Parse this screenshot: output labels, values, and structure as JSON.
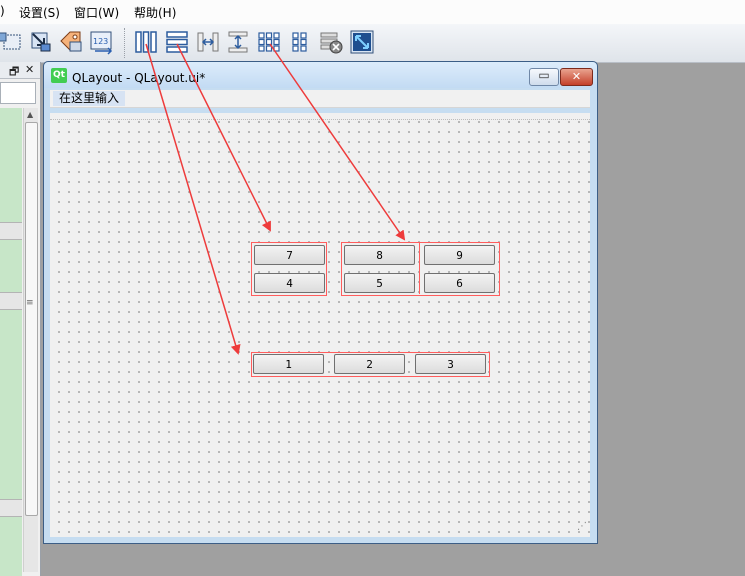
{
  "menubar": {
    "items": [
      ")",
      "设置(S)",
      "窗口(W)",
      "帮助(H)"
    ]
  },
  "toolbar": {
    "buttons": [
      "adjust-size-icon",
      "widget-editing-icon",
      "edit-buddies-icon",
      "tab-order-icon",
      "horizontal-layout-icon",
      "vertical-layout-icon",
      "horizontal-splitter-icon",
      "vertical-splitter-icon",
      "grid-layout-icon",
      "form-layout-icon",
      "break-layout-icon",
      "adjust-size-icon"
    ]
  },
  "left_panel": {
    "float_glyph": "🗗",
    "close_glyph": "✕",
    "scroll_grip": "≡"
  },
  "form_window": {
    "title": "QLayout - QLayout.ui*",
    "logo": "Qt",
    "minimize_glyph": "▭",
    "close_glyph": "✕",
    "menu_item": "在这里输入"
  },
  "buttons": {
    "b1": "1",
    "b2": "2",
    "b3": "3",
    "b4": "4",
    "b5": "5",
    "b6": "6",
    "b7": "7",
    "b8": "8",
    "b9": "9"
  },
  "colors": {
    "layout_border": "#ff5d5d",
    "arrow": "#ee3b3b",
    "widget_box_list": "#c7e6c8"
  }
}
